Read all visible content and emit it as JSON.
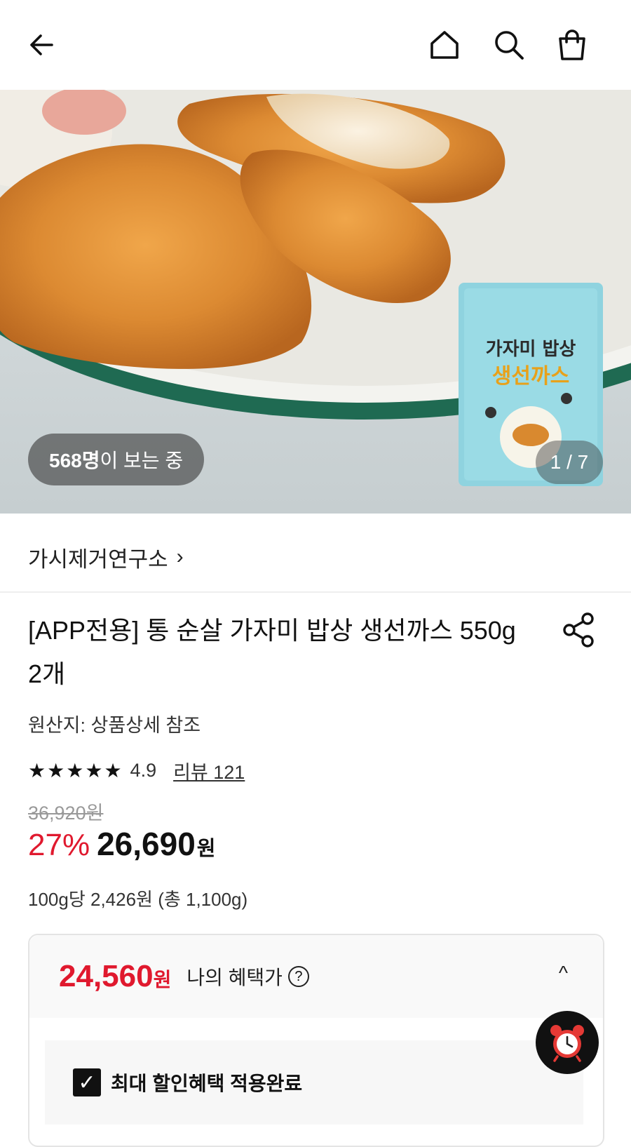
{
  "topbar": {
    "icons": [
      "arrow-left-icon",
      "home-icon",
      "search-icon",
      "shopping-bag-icon"
    ]
  },
  "gallery": {
    "viewers_count": "568명",
    "viewers_suffix": "이 보는 중",
    "page_indicator": "1 / 7",
    "package_text": {
      "line1": "가자미 밥상",
      "line2": "생선까스"
    }
  },
  "brand": {
    "name": "가시제거연구소",
    "chevron": "›"
  },
  "product": {
    "title": "[APP전용] 통 순살 가자미 밥상 생선까스 550g 2개",
    "origin": "원산지: 상품상세 참조",
    "rating": "4.9",
    "stars": [
      "★",
      "★",
      "★",
      "★",
      "★"
    ],
    "review_link": "리뷰 121",
    "original_price": "36,920원",
    "discount_rate": "27%",
    "sale_price": "26,690",
    "currency": "원",
    "unit_price": "100g당 2,426원 (총 1,100g)"
  },
  "benefit": {
    "price": "24,560",
    "currency": "원",
    "label": "나의 혜택가",
    "help": "?",
    "toggle": "^",
    "checkbox_label": "최대 할인혜택 적용완료",
    "checkbox_checked": true
  },
  "colors": {
    "accent_red": "#e0192e",
    "text": "#111111"
  }
}
